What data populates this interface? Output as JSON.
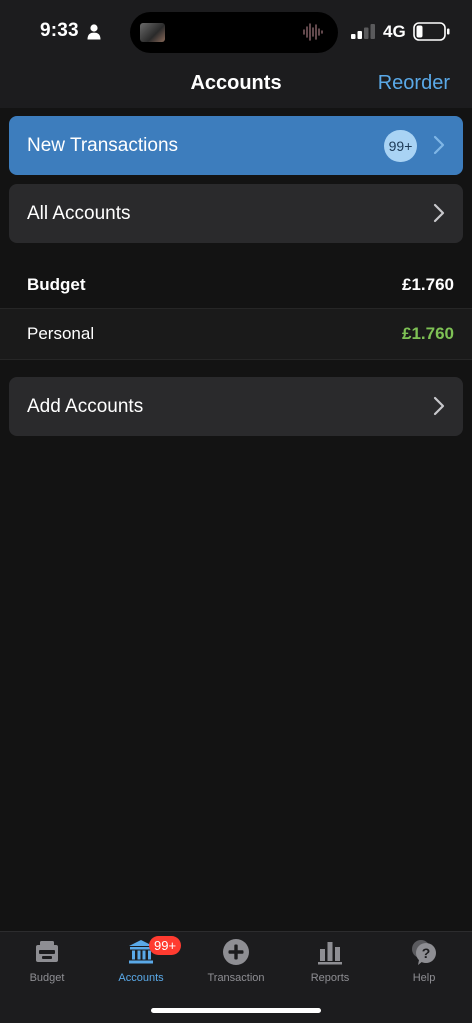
{
  "status_bar": {
    "time": "9:33",
    "network": "4G"
  },
  "nav": {
    "title": "Accounts",
    "reorder_label": "Reorder"
  },
  "new_transactions": {
    "label": "New Transactions",
    "badge": "99+"
  },
  "all_accounts": {
    "label": "All Accounts"
  },
  "budget": {
    "header_label": "Budget",
    "header_total": "£1.760",
    "accounts": [
      {
        "name": "Personal",
        "balance": "£1.760",
        "balance_color": "#7ec155"
      }
    ]
  },
  "add_accounts": {
    "label": "Add Accounts"
  },
  "tabs": [
    {
      "label": "Budget",
      "icon": "budget-icon"
    },
    {
      "label": "Accounts",
      "icon": "bank-icon",
      "badge": "99+",
      "active": true
    },
    {
      "label": "Transaction",
      "icon": "add-circle-icon"
    },
    {
      "label": "Reports",
      "icon": "bar-chart-icon"
    },
    {
      "label": "Help",
      "icon": "help-icon"
    }
  ],
  "colors": {
    "accent": "#5aa9e8",
    "highlight_card": "#3d7dbd",
    "badge_red": "#ff3b30",
    "positive": "#7ec155"
  }
}
